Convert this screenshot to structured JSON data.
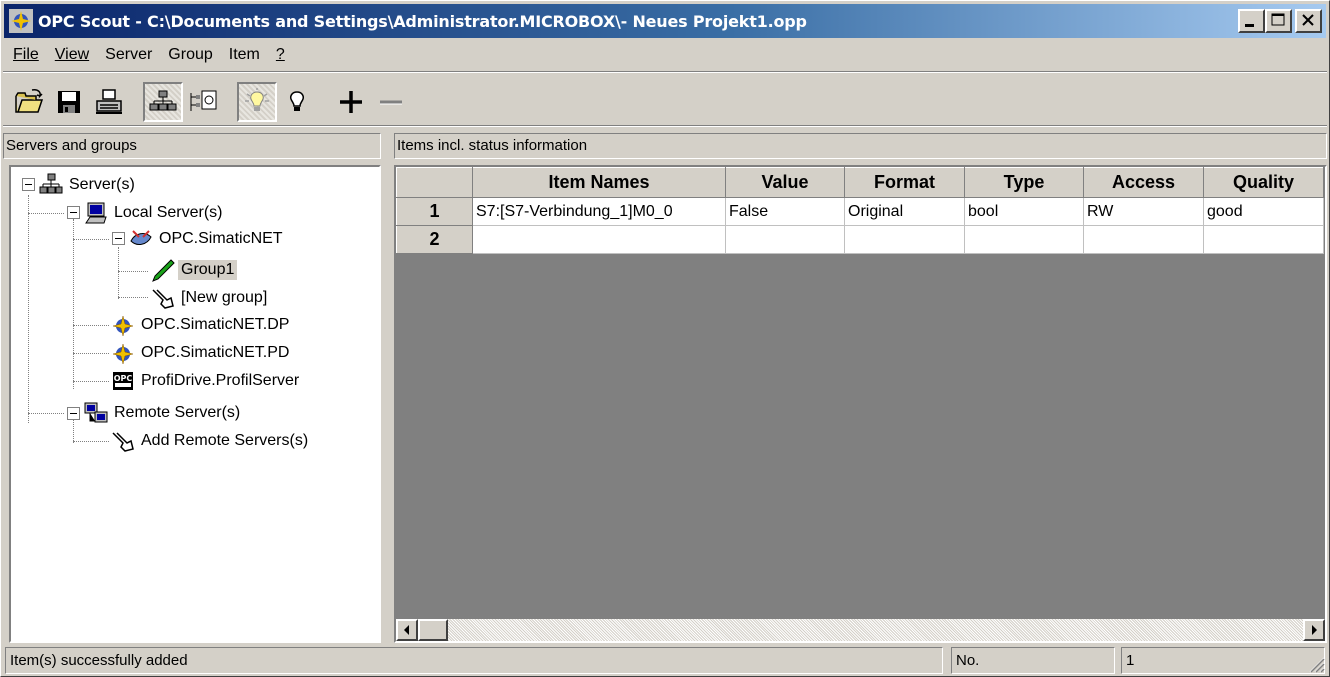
{
  "window": {
    "title": "OPC Scout - C:\\Documents and Settings\\Administrator.MICROBOX\\- Neues Projekt1.opp"
  },
  "menu": {
    "items": [
      {
        "label": "File",
        "underline": "F"
      },
      {
        "label": "View",
        "underline": "V"
      },
      {
        "label": "Server"
      },
      {
        "label": "Group"
      },
      {
        "label": "Item"
      },
      {
        "label": "?",
        "underline": "?"
      }
    ]
  },
  "toolbar": {
    "buttons": [
      "open-icon",
      "save-icon",
      "print-icon",
      "server-tree-icon",
      "group-properties-icon",
      "bulb-on-icon",
      "bulb-off-icon",
      "plus-icon",
      "minus-icon"
    ]
  },
  "left_panel": {
    "header": "Servers and groups",
    "tree": {
      "root": "Server(s)",
      "local": "Local Server(s)",
      "simaticnet": "OPC.SimaticNET",
      "group1": "Group1",
      "new_group": "[New group]",
      "dp": "OPC.SimaticNET.DP",
      "pd": "OPC.SimaticNET.PD",
      "profidrive": "ProfiDrive.ProfilServer",
      "remote": "Remote Server(s)",
      "add_remote": "Add Remote Servers(s)"
    }
  },
  "right_panel": {
    "header": "Items incl. status information",
    "columns": [
      "Item Names",
      "Value",
      "Format",
      "Type",
      "Access",
      "Quality"
    ],
    "rows": [
      {
        "num": "1",
        "cells": [
          "S7:[S7-Verbindung_1]M0_0",
          "False",
          "Original",
          "bool",
          "RW",
          "good"
        ]
      },
      {
        "num": "2",
        "cells": [
          "",
          "",
          "",
          "",
          "",
          ""
        ]
      }
    ]
  },
  "status": {
    "message": "Item(s) successfully added",
    "no_label": "No.",
    "no_value": "1"
  },
  "colors": {
    "title_active": "#0a246a",
    "face": "#d4d0c8",
    "group_icon": "#1aa31a"
  }
}
